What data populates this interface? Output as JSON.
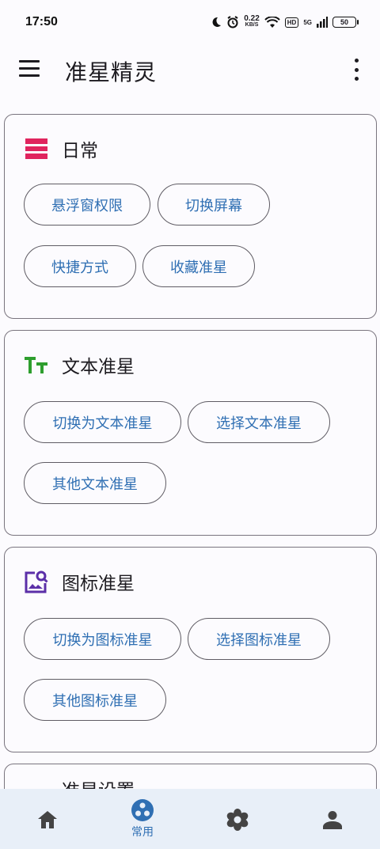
{
  "status_bar": {
    "time": "17:50",
    "net_speed_value": "0.22",
    "net_speed_unit": "KB/S",
    "hd_badge": "HD",
    "signal_label": "5G",
    "battery": "50",
    "icons": [
      "moon-icon",
      "alarm-icon",
      "wifi-icon",
      "signal-icon"
    ]
  },
  "app_bar": {
    "title": "准星精灵",
    "left_icon": "menu-icon",
    "right_icon": "more-vert-icon"
  },
  "cards": [
    {
      "title": "日常",
      "icon": "daily-icon",
      "icon_color": "#e0245e",
      "buttons": [
        "悬浮窗权限",
        "切换屏幕",
        "快捷方式",
        "收藏准星"
      ]
    },
    {
      "title": "文本准星",
      "icon": "text-icon",
      "icon_color": "#2e9e2e",
      "buttons": [
        "切换为文本准星",
        "选择文本准星",
        "其他文本准星"
      ]
    },
    {
      "title": "图标准星",
      "icon": "image-search-icon",
      "icon_color": "#5b2fa8",
      "buttons": [
        "切换为图标准星",
        "选择图标准星",
        "其他图标准星"
      ]
    },
    {
      "title": "准星设置",
      "icon": "settings-card-icon",
      "icon_color": "#e8552b",
      "buttons": []
    }
  ],
  "bottom_nav": {
    "items": [
      {
        "icon": "home-icon",
        "label": ""
      },
      {
        "icon": "common-icon",
        "label": "常用",
        "active": true
      },
      {
        "icon": "flower-icon",
        "label": ""
      },
      {
        "icon": "person-icon",
        "label": ""
      }
    ]
  },
  "colors": {
    "accent": "#2f6fb3",
    "background": "#fcfbfe",
    "nav_background": "#e8eff8",
    "outline": "#79747e"
  }
}
